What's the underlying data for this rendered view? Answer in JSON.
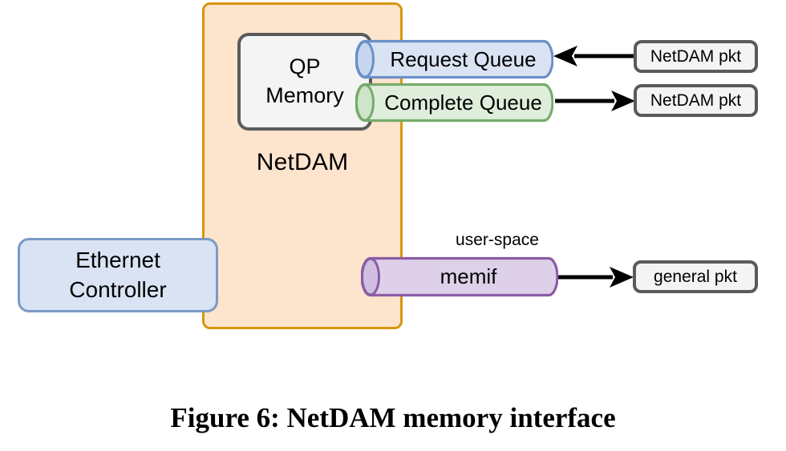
{
  "figure": {
    "caption": "Figure 6: NetDAM memory interface"
  },
  "container": {
    "label": "NetDAM",
    "fill_color": "#fde4cd",
    "border_color": "#d8960c"
  },
  "qp_memory": {
    "line1": "QP",
    "line2": "Memory",
    "fill_color": "#f4f4f4",
    "border_color": "#5a5a5a"
  },
  "ethernet_controller": {
    "line1": "Ethernet",
    "line2": "Controller",
    "fill_color": "#dae3f3",
    "border_color": "#7a9ac4"
  },
  "queues": [
    {
      "label": "Request Queue",
      "fill_color": "#dae3f3",
      "border_color": "#6b8fc9",
      "cap_color": "#c7d5ee"
    },
    {
      "label": "Complete Queue",
      "fill_color": "#dfeedb",
      "border_color": "#76ab6b",
      "cap_color": "#cfe5c9"
    }
  ],
  "memif": {
    "label": "memif",
    "annotation": "user-space",
    "fill_color": "#ddd0e8",
    "border_color": "#8b5ca5",
    "cap_color": "#d0bfe0"
  },
  "packets": [
    {
      "label": "NetDAM pkt",
      "direction": "left"
    },
    {
      "label": "NetDAM pkt",
      "direction": "right"
    },
    {
      "label": "general pkt",
      "direction": "right"
    }
  ]
}
